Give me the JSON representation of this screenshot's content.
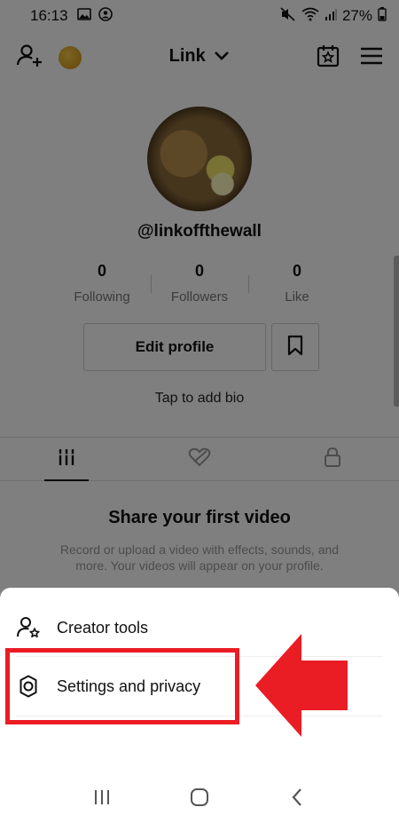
{
  "status_bar": {
    "time": "16:13",
    "battery": "27%"
  },
  "top_nav": {
    "account_name": "Link"
  },
  "profile": {
    "username": "@linkoffthewall",
    "stats": [
      {
        "value": "0",
        "label": "Following"
      },
      {
        "value": "0",
        "label": "Followers"
      },
      {
        "value": "0",
        "label": "Like"
      }
    ],
    "edit_button": "Edit profile",
    "bio_prompt": "Tap to add bio"
  },
  "empty_state": {
    "title": "Share your first video",
    "description": "Record or upload a video with effects, sounds, and more. Your videos will appear on your profile."
  },
  "menu": {
    "items": [
      {
        "label": "Creator tools",
        "icon": "creator-tools-icon"
      },
      {
        "label": "Settings and privacy",
        "icon": "gear-icon"
      }
    ]
  },
  "colors": {
    "highlight": "#ea1c24",
    "overlay": "rgba(0,0,0,0.5)"
  }
}
